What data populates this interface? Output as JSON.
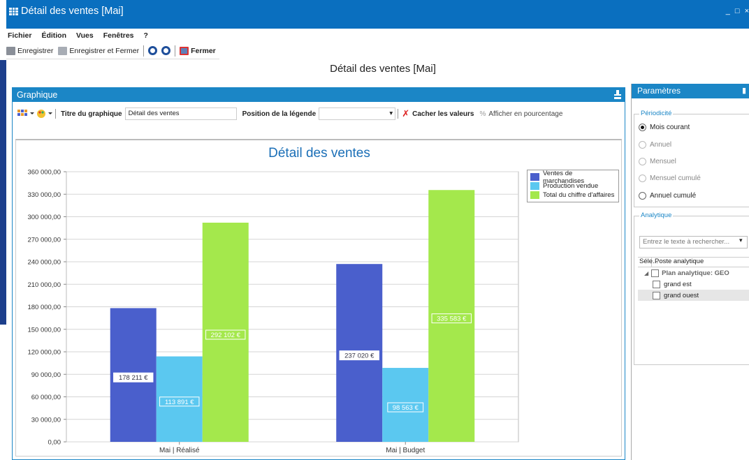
{
  "window": {
    "title": "Détail des ventes [Mai]",
    "controls": [
      "_",
      "□",
      "×"
    ]
  },
  "menu": [
    "Fichier",
    "Édition",
    "Vues",
    "Fenêtres",
    "?"
  ],
  "toolbar": {
    "save": "Enregistrer",
    "save_close": "Enregistrer et Fermer",
    "close": "Fermer"
  },
  "page_title": "Détail des ventes [Mai]",
  "graph_panel": {
    "title": "Graphique",
    "chart_title_label": "Titre du graphique",
    "chart_title_value": "Détail des ventes",
    "legend_position_label": "Position de la légende",
    "legend_position_value": "",
    "hide_values": "Cacher les valeurs",
    "show_percent": "Afficher en pourcentage"
  },
  "chart_data": {
    "type": "bar",
    "title": "Détail des ventes",
    "categories": [
      "Mai | Réalisé",
      "Mai | Budget"
    ],
    "series": [
      {
        "name": "Ventes de marchandises",
        "values": [
          178211,
          237020
        ],
        "labels": [
          "178 211 €",
          "237 020 €"
        ]
      },
      {
        "name": "Production vendue",
        "values": [
          113891,
          98563
        ],
        "labels": [
          "113 891 €",
          "98 563 €"
        ]
      },
      {
        "name": "Total du chiffre d'affaires",
        "values": [
          292102,
          335583
        ],
        "labels": [
          "292 102 €",
          "335 583 €"
        ]
      }
    ],
    "colors": [
      "#4a5fcc",
      "#5bc8f0",
      "#a4e84c"
    ],
    "ylim": [
      0,
      360000
    ],
    "yticks": [
      "0,00",
      "30 000,00",
      "60 000,00",
      "90 000,00",
      "120 000,00",
      "150 000,00",
      "180 000,00",
      "210 000,00",
      "240 000,00",
      "270 000,00",
      "300 000,00",
      "330 000,00",
      "360 000,00"
    ],
    "legend_position": "top-right",
    "grid": true
  },
  "params_panel": {
    "title": "Paramètres",
    "periodicity_label": "Périodicité",
    "options": [
      {
        "label": "Mois courant",
        "selected": true,
        "disabled": false
      },
      {
        "label": "Annuel",
        "selected": false,
        "disabled": true
      },
      {
        "label": "Mensuel",
        "selected": false,
        "disabled": true
      },
      {
        "label": "Mensuel cumulé",
        "selected": false,
        "disabled": true
      },
      {
        "label": "Annuel cumulé",
        "selected": false,
        "disabled": false
      }
    ],
    "analytic_label": "Analytique",
    "search_placeholder": "Entrez le texte à rechercher...",
    "grid_headers": [
      "Séle...",
      "Poste analytique"
    ],
    "tree_root": "Plan analytique: GEO",
    "tree_items": [
      "grand est",
      "grand ouest"
    ]
  },
  "colors": {
    "title_bar": "#0a6fbf",
    "panel_header": "#1b86c6",
    "accent_text": "#1b6fb7"
  }
}
